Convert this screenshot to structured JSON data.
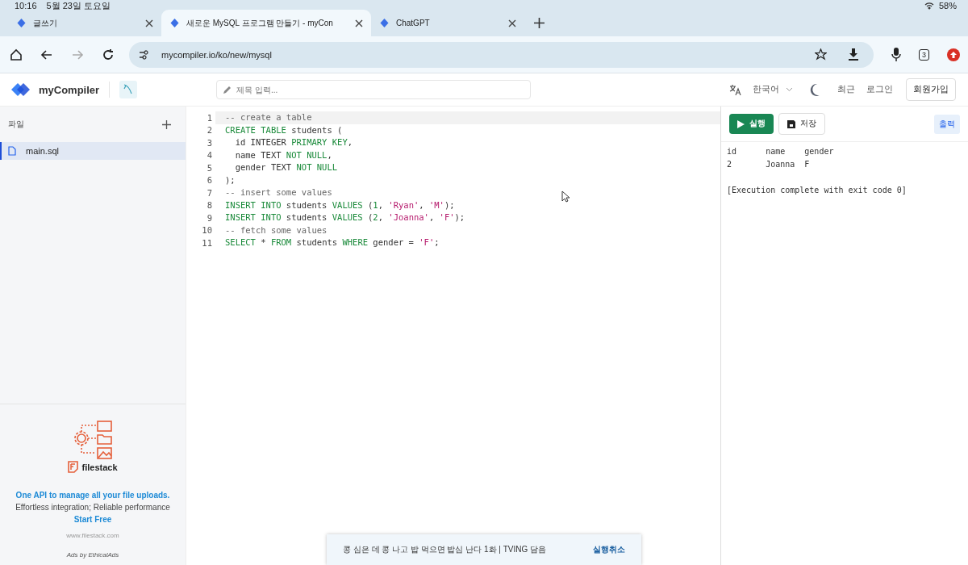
{
  "status_bar": {
    "time": "10:16",
    "date": "5월 23일 토요일",
    "battery": "58%"
  },
  "tabs": [
    {
      "title": "글쓰기",
      "selected": false
    },
    {
      "title": "새로운 MySQL 프로그램 만들기 - myCon",
      "selected": true
    },
    {
      "title": "ChatGPT",
      "selected": false
    }
  ],
  "toolbar": {
    "url": "mycompiler.io/ko/new/mysql",
    "tab_count": "3"
  },
  "header": {
    "logo": "myCompiler",
    "title_placeholder": "제목 입력...",
    "language": "한국어",
    "links": [
      "최근",
      "로그인"
    ],
    "signup": "회원가입"
  },
  "sidebar": {
    "heading": "파일",
    "files": [
      {
        "name": "main.sql",
        "selected": true
      }
    ],
    "ad": {
      "brand": "filestack",
      "text": "**One API to manage all your file uploads.** Effortless integration; Reliable performance",
      "link": "Start Free",
      "url": "www.filestack.com",
      "credit": "Ads by EthicalAds"
    }
  },
  "editor": {
    "lines": [
      [
        {
          "kind": "comment",
          "text": "-- create a table"
        }
      ],
      [
        {
          "kind": "kw",
          "text": "CREATE TABLE"
        },
        {
          "kind": "plain",
          "text": " students ("
        }
      ],
      [
        {
          "kind": "plain",
          "text": "  id INTEGER "
        },
        {
          "kind": "kw",
          "text": "PRIMARY KEY"
        },
        {
          "kind": "plain",
          "text": ","
        }
      ],
      [
        {
          "kind": "plain",
          "text": "  name TEXT "
        },
        {
          "kind": "kw",
          "text": "NOT NULL"
        },
        {
          "kind": "plain",
          "text": ","
        }
      ],
      [
        {
          "kind": "plain",
          "text": "  gender TEXT "
        },
        {
          "kind": "kw",
          "text": "NOT NULL"
        }
      ],
      [
        {
          "kind": "plain",
          "text": ");"
        }
      ],
      [
        {
          "kind": "comment",
          "text": "-- insert some values"
        }
      ],
      [
        {
          "kind": "kw",
          "text": "INSERT INTO"
        },
        {
          "kind": "plain",
          "text": " students "
        },
        {
          "kind": "kw",
          "text": "VALUES"
        },
        {
          "kind": "plain",
          "text": " ("
        },
        {
          "kind": "num",
          "text": "1"
        },
        {
          "kind": "plain",
          "text": ", "
        },
        {
          "kind": "str",
          "text": "'Ryan'"
        },
        {
          "kind": "plain",
          "text": ", "
        },
        {
          "kind": "str",
          "text": "'M'"
        },
        {
          "kind": "plain",
          "text": ");"
        }
      ],
      [
        {
          "kind": "kw",
          "text": "INSERT INTO"
        },
        {
          "kind": "plain",
          "text": " students "
        },
        {
          "kind": "kw",
          "text": "VALUES"
        },
        {
          "kind": "plain",
          "text": " ("
        },
        {
          "kind": "num",
          "text": "2"
        },
        {
          "kind": "plain",
          "text": ", "
        },
        {
          "kind": "str",
          "text": "'Joanna'"
        },
        {
          "kind": "plain",
          "text": ", "
        },
        {
          "kind": "str",
          "text": "'F'"
        },
        {
          "kind": "plain",
          "text": ");"
        }
      ],
      [
        {
          "kind": "comment",
          "text": "-- fetch some values"
        }
      ],
      [
        {
          "kind": "kw",
          "text": "SELECT"
        },
        {
          "kind": "plain",
          "text": " * "
        },
        {
          "kind": "kw",
          "text": "FROM"
        },
        {
          "kind": "plain",
          "text": " students "
        },
        {
          "kind": "kw",
          "text": "WHERE"
        },
        {
          "kind": "plain",
          "text": " gender = "
        },
        {
          "kind": "str",
          "text": "'F'"
        },
        {
          "kind": "plain",
          "text": ";"
        }
      ]
    ],
    "line_numbers": [
      "1",
      "2",
      "3",
      "4",
      "5",
      "6",
      "7",
      "8",
      "9",
      "10",
      "11"
    ]
  },
  "output": {
    "run": "실행",
    "save": "저장",
    "tab": "출력",
    "lines": [
      {
        "kind": "result",
        "text": "id      name    gender"
      },
      {
        "kind": "result",
        "text": "2       Joanna  F"
      },
      {
        "kind": "status",
        "text": "[Execution complete with exit code 0]"
      }
    ]
  },
  "snackbar": {
    "message": "콩 심은 데 콩 나고 밥 먹으면 밥심 난다 1화 | TVING 담음",
    "action": "실행취소"
  }
}
